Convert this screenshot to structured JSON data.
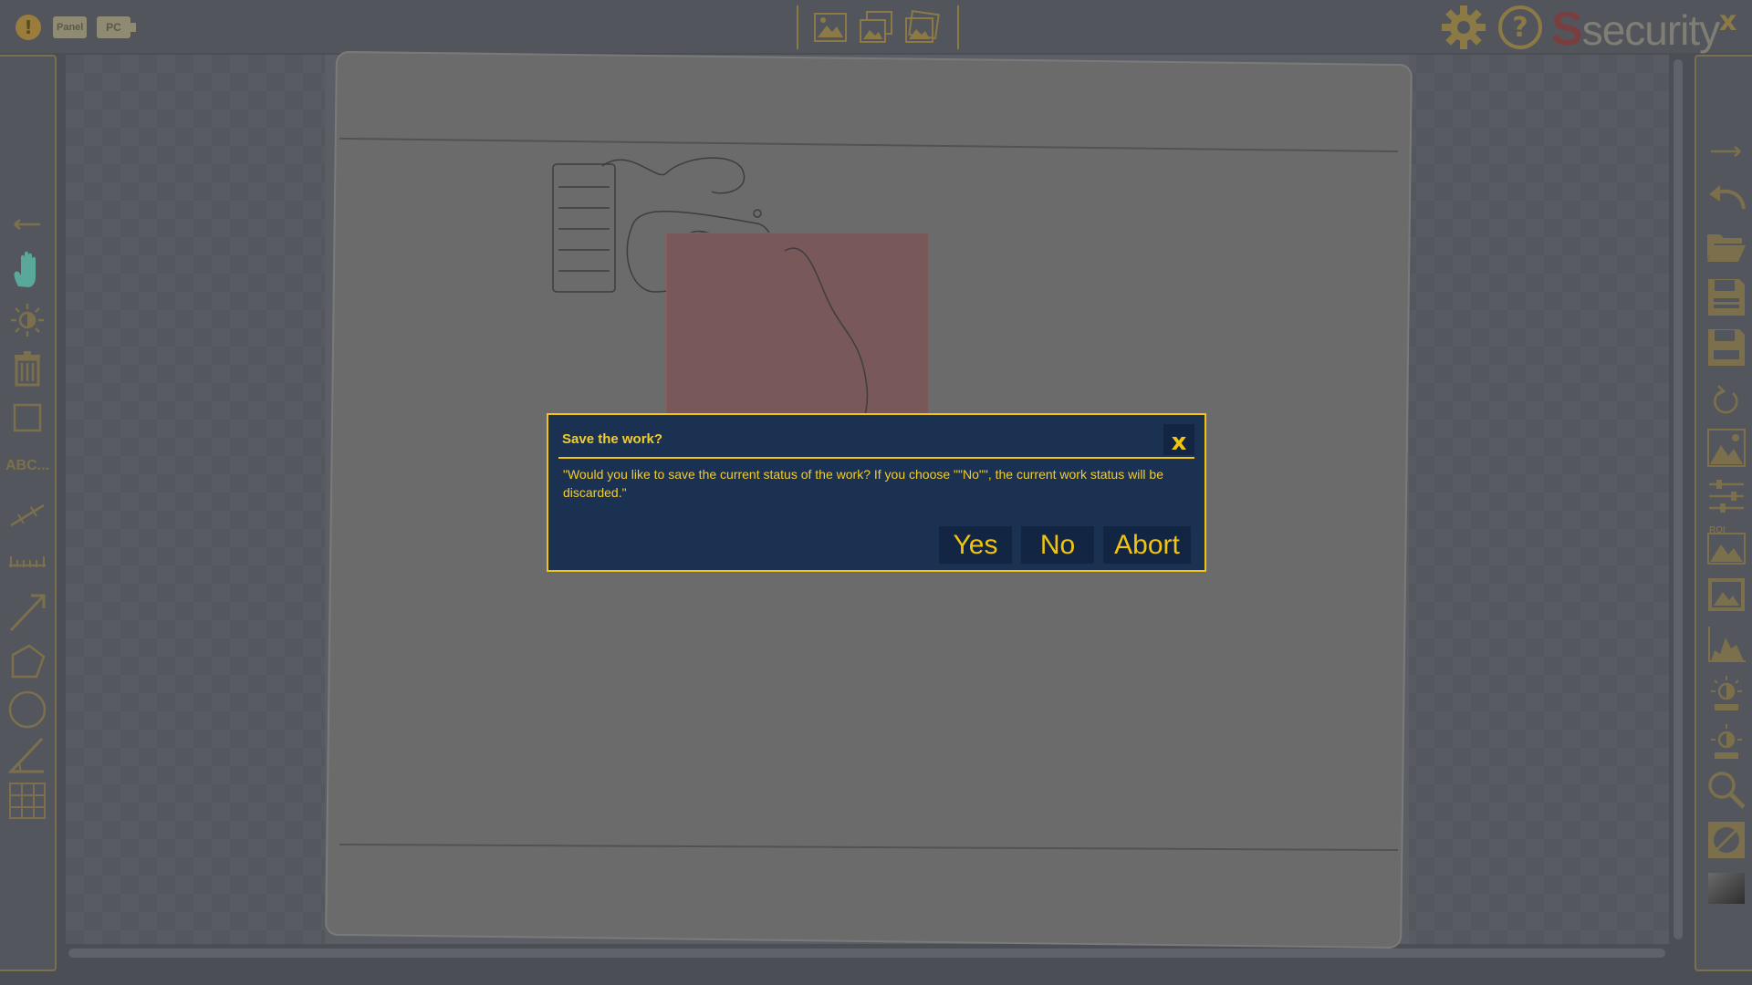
{
  "topbar": {
    "warning_icon_glyph": "!",
    "panel_chip": "Panel",
    "pc_chip": "PC",
    "view_buttons": [
      "image-view-icon",
      "compare-view-icon",
      "overlay-view-icon"
    ],
    "brand_s": "S",
    "brand_text": "security",
    "close_glyph": "x"
  },
  "left_toolbar": {
    "abc_label": "ABC..."
  },
  "dialog": {
    "title": "Save the work?",
    "close_glyph": "x",
    "message": "\"Would you like to save the current status of the work? If you choose \"\"No\"\", the current work status will be discarded.\"",
    "yes_label": "Yes",
    "no_label": "No",
    "abort_label": "Abort"
  },
  "colors": {
    "accent": "#f1c40f",
    "dialog_bg": "#1b3152",
    "button_bg": "#122542",
    "toolbar_border": "#7c6f4b"
  }
}
